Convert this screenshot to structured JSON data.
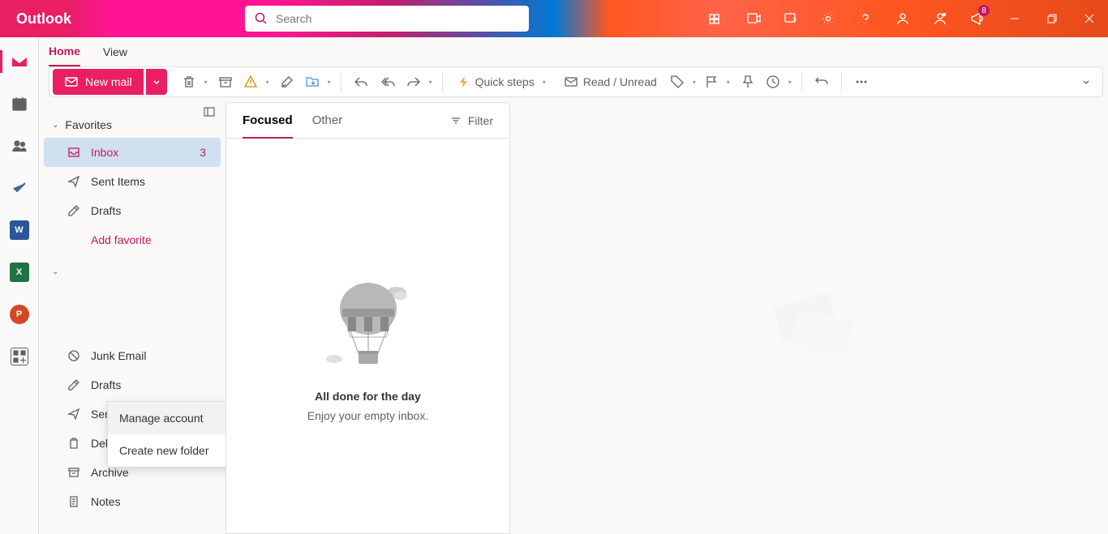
{
  "app_name": "Outlook",
  "search": {
    "placeholder": "Search"
  },
  "title_bar": {
    "badge_count": "8"
  },
  "tabs": {
    "home": "Home",
    "view": "View"
  },
  "new_mail": "New mail",
  "ribbon": {
    "quick_steps": "Quick steps",
    "read_unread": "Read / Unread"
  },
  "folder_pane": {
    "favorites": "Favorites",
    "inbox": {
      "label": "Inbox",
      "count": "3"
    },
    "sent": "Sent Items",
    "drafts": "Drafts",
    "add_favorite": "Add favorite",
    "junk": "Junk Email",
    "drafts2": "Drafts",
    "sent2": "Sent Items",
    "deleted": "Deleted Items",
    "archive": "Archive",
    "notes": "Notes"
  },
  "context_menu": {
    "manage_account": "Manage account",
    "create_folder": "Create new folder"
  },
  "msg_list": {
    "focused": "Focused",
    "other": "Other",
    "filter": "Filter",
    "empty_title": "All done for the day",
    "empty_sub": "Enjoy your empty inbox."
  },
  "rail_apps": {
    "word": "W",
    "excel": "X",
    "ppt": "P"
  }
}
